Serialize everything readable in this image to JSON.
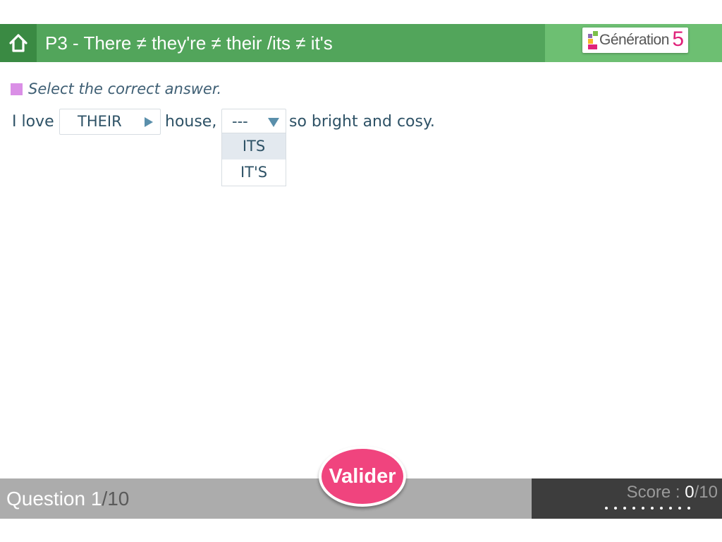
{
  "header": {
    "title": "P3 - There ≠ they're ≠ their /its ≠ it's",
    "logo_text": "Génération",
    "logo_number": "5"
  },
  "instruction": "Select the correct answer.",
  "sentence": {
    "part1": "I love",
    "part2": "house,",
    "part3": "so bright and cosy.",
    "select1_value": "THEIR",
    "select2_value": "---",
    "select2_options": [
      "ITS",
      "IT'S"
    ]
  },
  "footer": {
    "question_label": "Question",
    "question_current": "1",
    "question_total": "/10",
    "score_label": "Score : ",
    "score_current": "0",
    "score_total": "/10",
    "progress_dots": 10
  },
  "valider_label": "Valider",
  "colors": {
    "header_green": "#52a55b",
    "home_green": "#3a8a43",
    "logo_area_green": "#6dbf72",
    "valider_pink": "#f0447e",
    "instruction_marker": "#da8fe6",
    "footer_gray": "#acacac",
    "footer_dark": "#3d3d3d"
  },
  "icons": {
    "home": "home-icon",
    "select_arrow_right": "triangle-right-icon",
    "select_arrow_down": "triangle-down-icon"
  }
}
